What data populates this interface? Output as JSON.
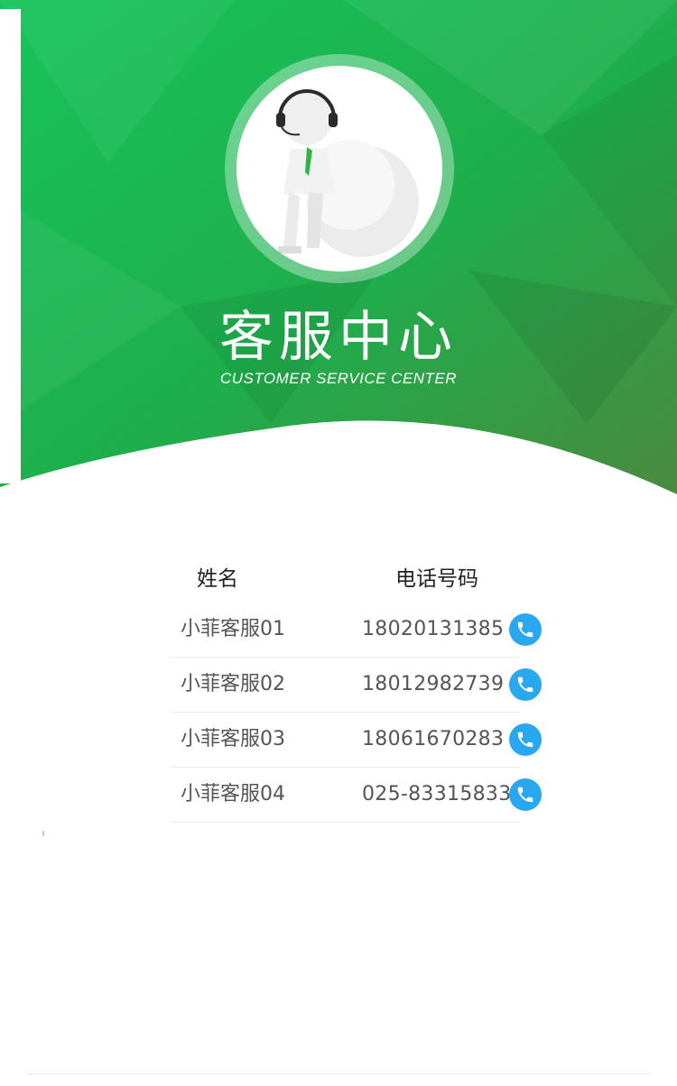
{
  "header": {
    "title": "客服中心",
    "subtitle": "CUSTOMER SERVICE CENTER",
    "avatar_icon": "customer-service-agent-icon"
  },
  "colors": {
    "brand_green": "#1ec05a",
    "dark_green": "#3f8a3e",
    "call_blue": "#2aa7f1"
  },
  "table": {
    "headers": {
      "name": "姓名",
      "phone": "电话号码"
    },
    "rows": [
      {
        "name": "小菲客服01",
        "phone": "18020131385",
        "icon": "phone-icon"
      },
      {
        "name": "小菲客服02",
        "phone": "18012982739",
        "icon": "phone-icon"
      },
      {
        "name": "小菲客服03",
        "phone": "18061670283",
        "icon": "phone-icon"
      },
      {
        "name": "小菲客服04",
        "phone": "025-83315833",
        "icon": "phone-icon"
      }
    ]
  }
}
